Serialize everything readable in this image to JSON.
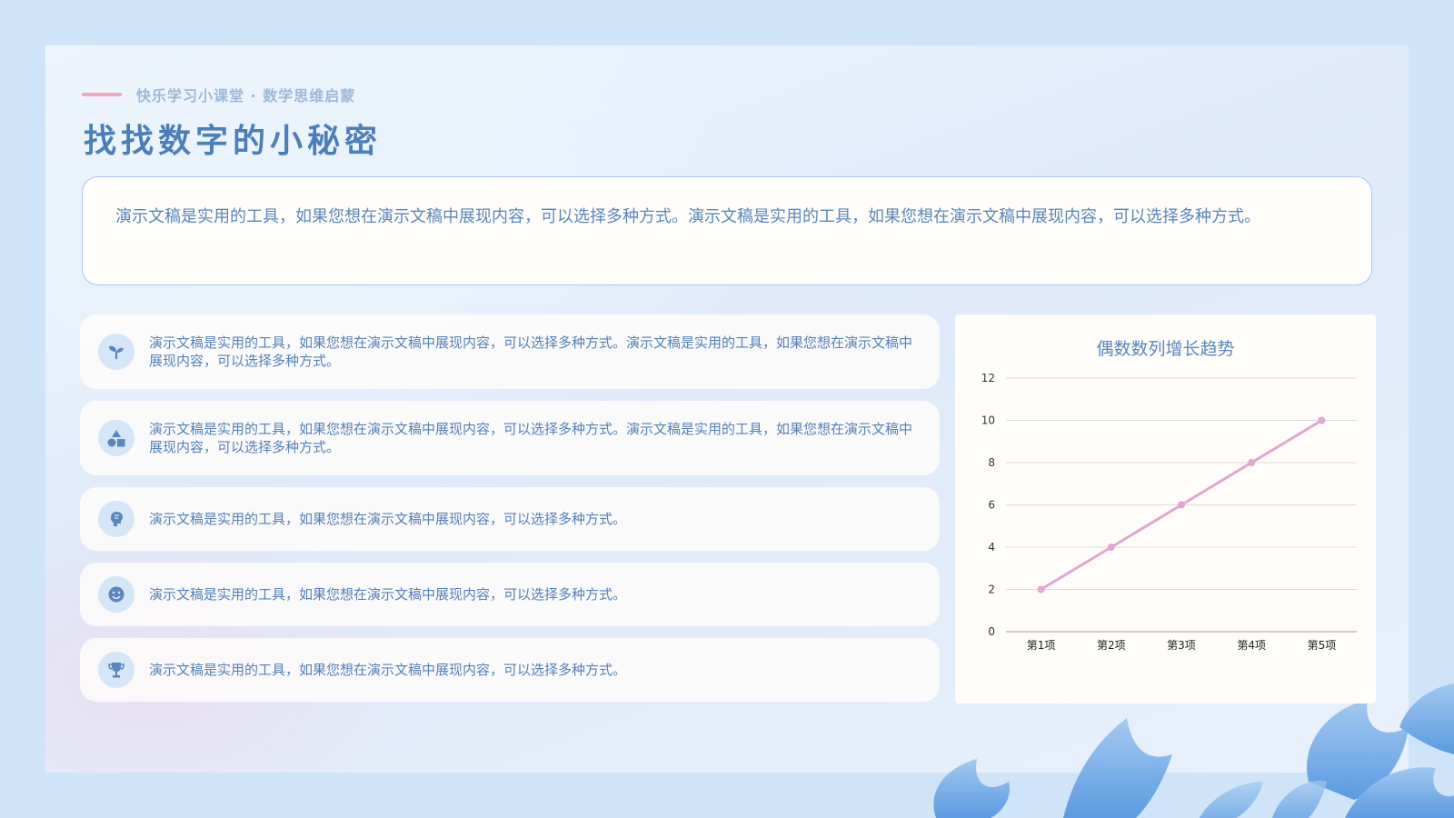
{
  "header": {
    "subtitle": "快乐学习小课堂 · 数学思维启蒙",
    "title": "找找数字的小秘密"
  },
  "intro": {
    "text": "演示文稿是实用的工具，如果您想在演示文稿中展现内容，可以选择多种方式。演示文稿是实用的工具，如果您想在演示文稿中展现内容，可以选择多种方式。"
  },
  "items": [
    {
      "icon": "seedling-icon",
      "text": "演示文稿是实用的工具，如果您想在演示文稿中展现内容，可以选择多种方式。演示文稿是实用的工具，如果您想在演示文稿中展现内容，可以选择多种方式。"
    },
    {
      "icon": "shapes-icon",
      "text": "演示文稿是实用的工具，如果您想在演示文稿中展现内容，可以选择多种方式。演示文稿是实用的工具，如果您想在演示文稿中展现内容，可以选择多种方式。"
    },
    {
      "icon": "brain-icon",
      "text": "演示文稿是实用的工具，如果您想在演示文稿中展现内容，可以选择多种方式。"
    },
    {
      "icon": "smile-icon",
      "text": "演示文稿是实用的工具，如果您想在演示文稿中展现内容，可以选择多种方式。"
    },
    {
      "icon": "trophy-icon",
      "text": "演示文稿是实用的工具，如果您想在演示文稿中展现内容，可以选择多种方式。"
    }
  ],
  "colors": {
    "title": "#4b7fb9",
    "accent": "#f1a9c1",
    "line": "#e0a6cf",
    "icon": "#5a86bb"
  },
  "chart_data": {
    "type": "line",
    "title": "偶数数列增长趋势",
    "categories": [
      "第1项",
      "第2项",
      "第3项",
      "第4项",
      "第5项"
    ],
    "series": [
      {
        "values": [
          2,
          4,
          6,
          8,
          10
        ]
      }
    ],
    "ylim": [
      0,
      12
    ],
    "yticks": [
      0,
      2,
      4,
      6,
      8,
      10,
      12
    ],
    "grid": true,
    "legend": "none"
  }
}
